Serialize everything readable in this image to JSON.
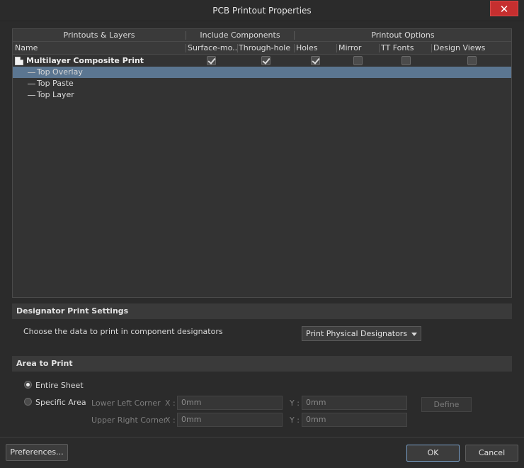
{
  "window": {
    "title": "PCB Printout Properties",
    "close_label": "✕"
  },
  "grid": {
    "group_headers": [
      "Printouts & Layers",
      "Include Components",
      "Printout Options"
    ],
    "columns": [
      "Name",
      "Surface-mo...",
      "Through-hole",
      "Holes",
      "Mirror",
      "TT Fonts",
      "Design Views"
    ],
    "printout": {
      "name": "Multilayer Composite Print",
      "checks": [
        true,
        true,
        true,
        false,
        false,
        false
      ]
    },
    "layers": [
      "Top Overlay",
      "Top Paste",
      "Top Layer"
    ]
  },
  "designator": {
    "header": "Designator Print Settings",
    "prompt": "Choose the data to print in component designators",
    "selected": "Print Physical Designators"
  },
  "area": {
    "header": "Area to Print",
    "entire_sheet": "Entire Sheet",
    "specific_area": "Specific Area",
    "lower_left": "Lower Left Corner",
    "upper_right": "Upper Right Corner",
    "x_label": "X :",
    "y_label": "Y :",
    "ll_x": "0mm",
    "ll_y": "0mm",
    "ur_x": "0mm",
    "ur_y": "0mm",
    "define": "Define"
  },
  "footer": {
    "preferences": "Preferences...",
    "ok": "OK",
    "cancel": "Cancel"
  }
}
